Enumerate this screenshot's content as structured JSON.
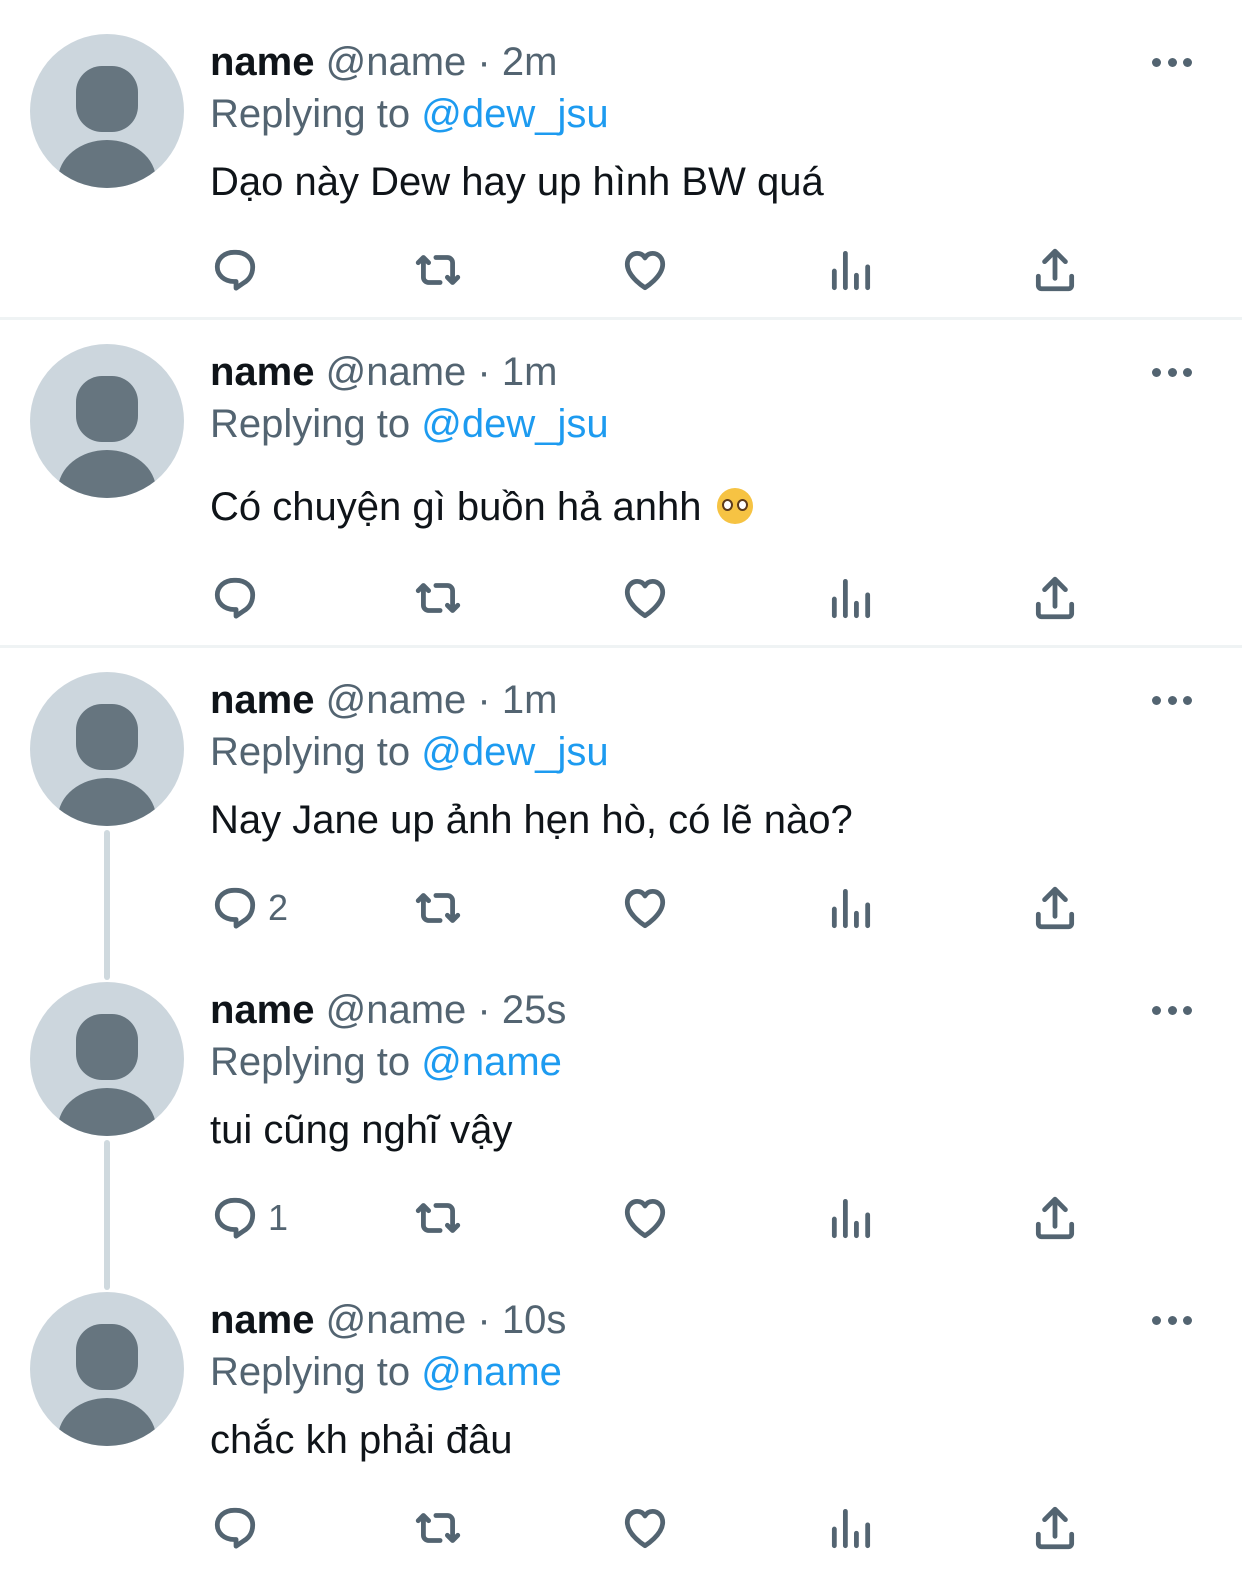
{
  "tweets": [
    {
      "name": "name",
      "handle": "@name",
      "dot": "·",
      "time": "2m",
      "replying_prefix": "Replying to",
      "replying_to": "@dew_jsu",
      "text": "Dạo này Dew hay up hình BW quá",
      "reply_count": ""
    },
    {
      "name": "name",
      "handle": "@name",
      "dot": "·",
      "time": "1m",
      "replying_prefix": "Replying to",
      "replying_to": "@dew_jsu",
      "text": "Có chuyện gì buồn hả anhh",
      "emoji": "pleading-face",
      "reply_count": ""
    },
    {
      "name": "name",
      "handle": "@name",
      "dot": "·",
      "time": "1m",
      "replying_prefix": "Replying to",
      "replying_to": "@dew_jsu",
      "text": "Nay Jane up ảnh hẹn hò, có lẽ nào?",
      "reply_count": "2"
    },
    {
      "name": "name",
      "handle": "@name",
      "dot": "·",
      "time": "25s",
      "replying_prefix": "Replying to",
      "replying_to": "@name",
      "text": "tui cũng nghĩ vậy",
      "reply_count": "1"
    },
    {
      "name": "name",
      "handle": "@name",
      "dot": "·",
      "time": "10s",
      "replying_prefix": "Replying to",
      "replying_to": "@name",
      "text": "chắc kh phải đâu",
      "reply_count": ""
    }
  ],
  "icons": {
    "reply": "reply-icon",
    "retweet": "retweet-icon",
    "like": "heart-icon",
    "views": "analytics-icon",
    "share": "share-icon",
    "more": "more-icon"
  },
  "colors": {
    "link": "#1d9bf0",
    "secondary": "#536471",
    "avatar_bg": "#ccd6dd",
    "avatar_fg": "#66757f"
  }
}
